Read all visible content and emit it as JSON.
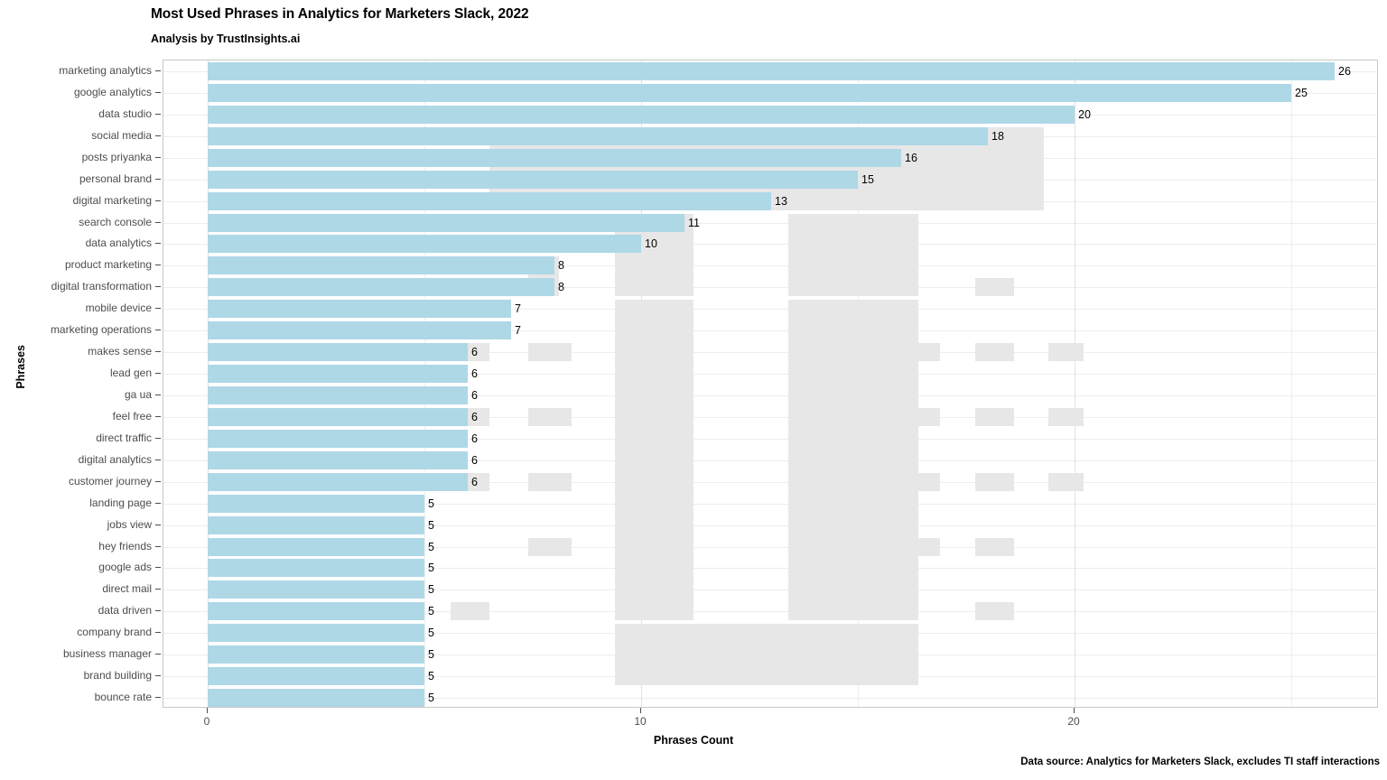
{
  "title": "Most Used Phrases in Analytics for Marketers Slack, 2022",
  "subtitle": "Analysis by TrustInsights.ai",
  "caption": "Data source: Analytics for Marketers Slack, excludes TI staff interactions",
  "chart_data": {
    "type": "bar",
    "orientation": "horizontal",
    "title": "Most Used Phrases in Analytics for Marketers Slack, 2022",
    "subtitle": "Analysis by TrustInsights.ai",
    "xlabel": "Phrases Count",
    "ylabel": "Phrases",
    "xlim": [
      0,
      28.06
    ],
    "xticks": [
      0,
      10,
      20
    ],
    "xtick_labels": [
      "0",
      "10",
      "20"
    ],
    "grid": true,
    "legend": "none",
    "bar_color": "#aed8e6",
    "overlay_color": "#e7e7e7",
    "categories": [
      "marketing analytics",
      "google analytics",
      "data studio",
      "social media",
      "posts priyanka",
      "personal brand",
      "digital marketing",
      "search console",
      "data analytics",
      "product marketing",
      "digital transformation",
      "mobile device",
      "marketing operations",
      "makes sense",
      "lead gen",
      "ga ua",
      "feel free",
      "direct traffic",
      "digital analytics",
      "customer journey",
      "landing page",
      "jobs view",
      "hey friends",
      "google ads",
      "direct mail",
      "data driven",
      "company brand",
      "business manager",
      "brand building",
      "bounce rate"
    ],
    "values": [
      26,
      25,
      20,
      18,
      16,
      15,
      13,
      11,
      10,
      8,
      8,
      7,
      7,
      6,
      6,
      6,
      6,
      6,
      6,
      6,
      5,
      5,
      5,
      5,
      5,
      5,
      5,
      5,
      5,
      5
    ],
    "value_labels": [
      "26",
      "25",
      "20",
      "18",
      "16",
      "15",
      "13",
      "11",
      "10",
      "8",
      "8",
      "7",
      "7",
      "6",
      "6",
      "6",
      "6",
      "6",
      "6",
      "6",
      "5",
      "5",
      "5",
      "5",
      "5",
      "5",
      "5",
      "5",
      "5",
      "5"
    ],
    "overlay_blocks": [
      {
        "x0": 6.5,
        "x1": 19.3,
        "row0": 2,
        "row1": 2
      },
      {
        "x0": 6.5,
        "x1": 19.3,
        "row0": 3,
        "row1": 6
      },
      {
        "x0": 6.5,
        "x1": 8.1,
        "row0": 7,
        "row1": 7
      },
      {
        "x0": 9.4,
        "x1": 11.2,
        "row0": 7,
        "row1": 10
      },
      {
        "x0": 13.4,
        "x1": 16.4,
        "row0": 7,
        "row1": 10
      },
      {
        "x0": 7.4,
        "x1": 8.1,
        "row0": 9,
        "row1": 10
      },
      {
        "x0": 17.7,
        "x1": 18.6,
        "row0": 10,
        "row1": 10
      },
      {
        "x0": 5.6,
        "x1": 6.5,
        "row0": 13,
        "row1": 13
      },
      {
        "x0": 7.4,
        "x1": 8.4,
        "row0": 13,
        "row1": 13
      },
      {
        "x0": 16.0,
        "x1": 16.9,
        "row0": 13,
        "row1": 13
      },
      {
        "x0": 17.7,
        "x1": 18.6,
        "row0": 13,
        "row1": 13
      },
      {
        "x0": 19.4,
        "x1": 20.2,
        "row0": 13,
        "row1": 13
      },
      {
        "x0": 5.6,
        "x1": 6.5,
        "row0": 16,
        "row1": 16
      },
      {
        "x0": 7.4,
        "x1": 8.4,
        "row0": 16,
        "row1": 16
      },
      {
        "x0": 16.0,
        "x1": 16.9,
        "row0": 16,
        "row1": 16
      },
      {
        "x0": 17.7,
        "x1": 18.6,
        "row0": 16,
        "row1": 16
      },
      {
        "x0": 19.4,
        "x1": 20.2,
        "row0": 16,
        "row1": 16
      },
      {
        "x0": 5.6,
        "x1": 6.5,
        "row0": 19,
        "row1": 19
      },
      {
        "x0": 7.4,
        "x1": 8.4,
        "row0": 19,
        "row1": 19
      },
      {
        "x0": 16.0,
        "x1": 16.9,
        "row0": 19,
        "row1": 19
      },
      {
        "x0": 17.7,
        "x1": 18.6,
        "row0": 19,
        "row1": 19
      },
      {
        "x0": 19.4,
        "x1": 20.2,
        "row0": 19,
        "row1": 19
      },
      {
        "x0": 7.4,
        "x1": 8.4,
        "row0": 22,
        "row1": 22
      },
      {
        "x0": 16.0,
        "x1": 16.9,
        "row0": 22,
        "row1": 22
      },
      {
        "x0": 17.7,
        "x1": 18.6,
        "row0": 22,
        "row1": 22
      },
      {
        "x0": 5.6,
        "x1": 6.5,
        "row0": 25,
        "row1": 25
      },
      {
        "x0": 17.7,
        "x1": 18.6,
        "row0": 25,
        "row1": 25
      },
      {
        "x0": 9.4,
        "x1": 11.2,
        "row0": 11,
        "row1": 25
      },
      {
        "x0": 13.4,
        "x1": 16.4,
        "row0": 11,
        "row1": 25
      },
      {
        "x0": 9.4,
        "x1": 16.4,
        "row0": 26,
        "row1": 28
      }
    ]
  }
}
